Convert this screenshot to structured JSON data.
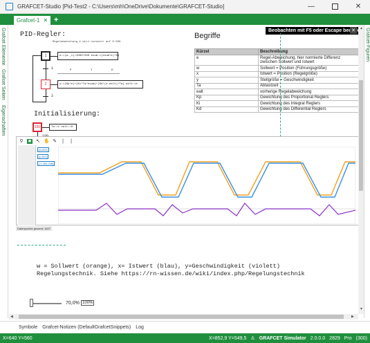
{
  "window": {
    "title": "GRAFCET-Studio [Pid-Test2 - C:\\Users\\mh\\OneDrive\\Dokumente\\GRAFCET-Studio]",
    "minimize": "—",
    "close": "✕"
  },
  "tabs": [
    {
      "label": "Grafcet-1",
      "close": "✕"
    }
  ],
  "tab_add": "+",
  "left_panels": [
    "Grafcet Elemente",
    "Grafcet Seiten",
    "Eigenschaften"
  ],
  "right_panel": "Grafcet-Figuren",
  "banner": {
    "text": "Beobachten mit F5 oder Escape beenden",
    "close": "✕"
  },
  "grafcet": {
    "pid_title": "PID-Regler:",
    "pid_note": "Regelabweichung e wird normiert auf 0-500",
    "steps": [
      "1",
      "2",
      "100"
    ],
    "transitions": [
      "1",
      "2",
      "100"
    ],
    "actions": [
      "e:=(w-_x)/1000*500  esum:=(esum+e)*Kz",
      "y:=(Kp*e)+(Ki*Ta*esum)+(Kd*(e-ealt)/Ta)  ealt:=e",
      "Ta:=1  ealt:=0",
      "esum:=0"
    ],
    "cond_labels": [
      "P",
      "I",
      "D"
    ],
    "init_title": "Initialisierung:"
  },
  "terms": {
    "title": "Begriffe",
    "headers": [
      "Kürzel",
      "Beschreibung"
    ],
    "rows": [
      [
        "e",
        "Regel-Abweichung, hier normierte Differenz zwischen Sollwert und Istwert"
      ],
      [
        "w",
        "Sollwert = Position (Führungsgröße)"
      ],
      [
        "x",
        "Istwert = Position (Regelgröße)"
      ],
      [
        "y",
        "Stellgröße = Geschwindigkeit"
      ],
      [
        "Ta",
        "Abtastzeit"
      ],
      [
        "ealt",
        "vorherige Regelabweichung"
      ],
      [
        "Kp",
        "Gewichtung des Proportional Reglers"
      ],
      [
        "Ki",
        "Gewichtung des Integral Reglers"
      ],
      [
        "Kd",
        "Gewichtung des Differential Reglers"
      ]
    ]
  },
  "simulator": {
    "tools": [
      "⚲",
      "■",
      "↖",
      "✋",
      "✎",
      "|",
      "|"
    ],
    "signals": [
      {
        "label": "[w,604]"
      },
      {
        "label": "[x,567]"
      },
      {
        "label": "[-1.264,248]"
      }
    ],
    "status": "Datenpunkte gesamt: 1827",
    "colors": {
      "w": "#f0a020",
      "x": "#3a8fe0",
      "y": "#8a2fc8"
    }
  },
  "description": {
    "line1": "w = Sollwert (orange), x= Istwert (blau), y=Geschwindigkeit (violett)",
    "line2": "Regelungstechnik. Siehe https://rn-wissen.de/wiki/index.php/Regelungstechnik"
  },
  "zoom": {
    "label": "70,0%",
    "button": "100%"
  },
  "bottom_tabs": [
    "Symbole",
    "Grafcet-Notizen (DefaultGrafcetSnippets)",
    "Log"
  ],
  "status": {
    "left": "X=640 Y=560",
    "coords": "X=852,9  Y=549,5",
    "app": "GRAFCET Simulator",
    "version": "2.0.0.0",
    "build": "2829",
    "edition": "Pro",
    "extra": "(300)"
  }
}
